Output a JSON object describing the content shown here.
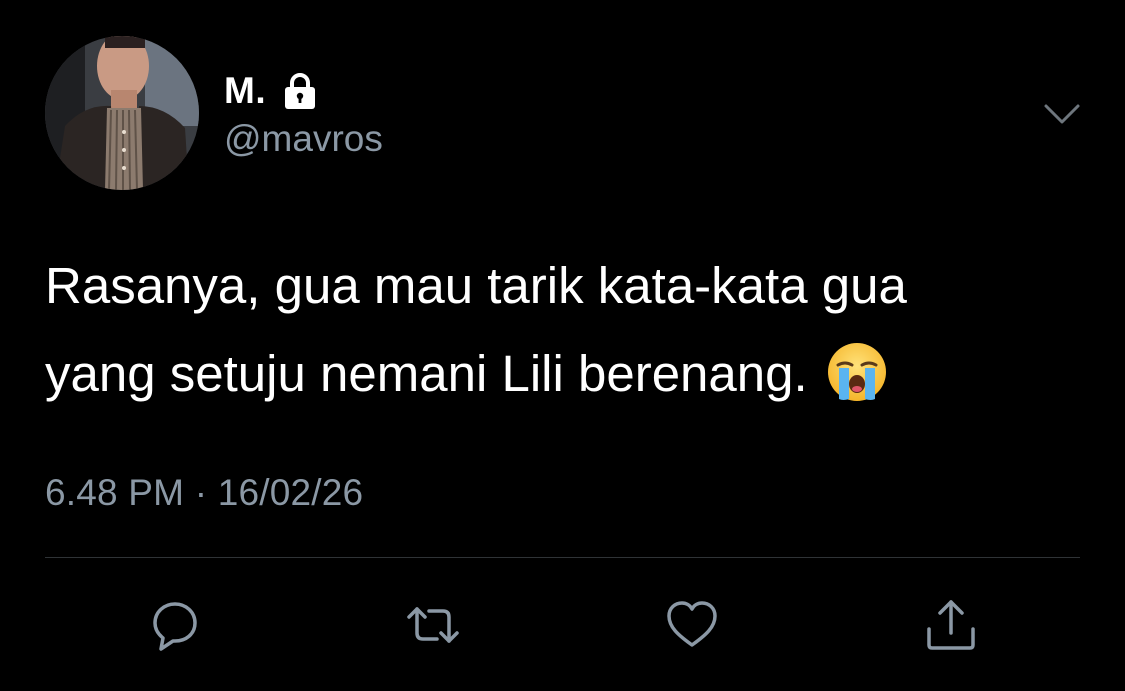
{
  "user": {
    "display_name": "M.",
    "handle": "@mavros",
    "protected_icon": "lock-icon"
  },
  "tweet": {
    "text_line1": "Rasanya, gua mau tarik kata-kata gua",
    "text_line2": "yang setuju nemani Lili berenang.",
    "emoji": "loudly-crying-face",
    "time": "6.48 PM",
    "separator": "·",
    "date": "16/02/26"
  },
  "actions": [
    {
      "name": "reply",
      "icon": "reply-icon"
    },
    {
      "name": "retweet",
      "icon": "retweet-icon"
    },
    {
      "name": "like",
      "icon": "heart-icon"
    },
    {
      "name": "share",
      "icon": "share-icon"
    }
  ],
  "colors": {
    "background": "#000000",
    "primary_text": "#ffffff",
    "secondary_text": "#8b98a5",
    "divider": "#2f3336",
    "icon": "#8b98a5"
  }
}
